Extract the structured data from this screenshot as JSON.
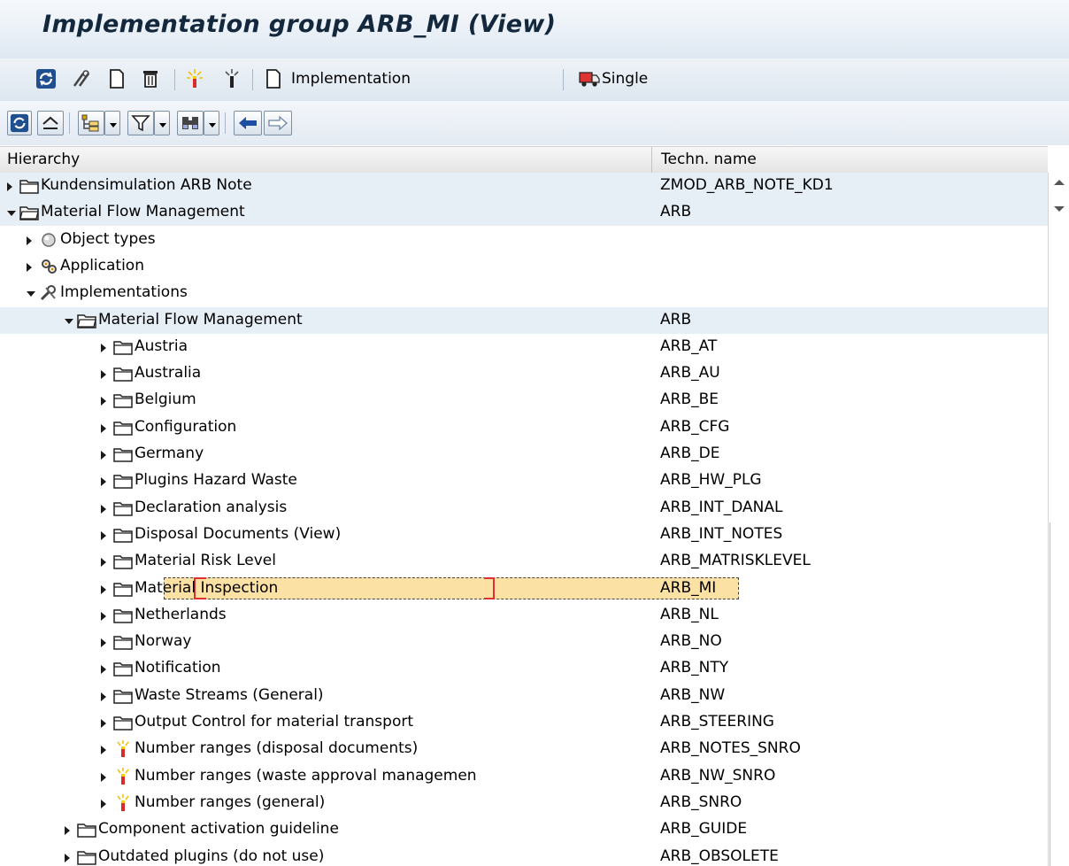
{
  "window": {
    "title": "Implementation group ARB_MI (View)"
  },
  "app_toolbar": {
    "implementation_label": "Implementation",
    "single_label": "Single"
  },
  "tree_header": {
    "hierarchy": "Hierarchy",
    "techn_name": "Techn. name"
  },
  "tree": [
    {
      "label": "Kundensimulation ARB Note",
      "tech": "ZMOD_ARB_NOTE_KD1",
      "level": 0,
      "state": "collapsed",
      "icon": "folder-icon"
    },
    {
      "label": "Material Flow Management",
      "tech": "ARB",
      "level": 0,
      "state": "expanded",
      "icon": "folder-open-icon"
    },
    {
      "label": "Object types",
      "tech": "",
      "level": 1,
      "state": "collapsed",
      "icon": "object-type-icon"
    },
    {
      "label": "Application",
      "tech": "",
      "level": 1,
      "state": "collapsed",
      "icon": "application-icon"
    },
    {
      "label": "Implementations",
      "tech": "",
      "level": 1,
      "state": "expanded",
      "icon": "tools-icon"
    },
    {
      "label": "Material Flow Management",
      "tech": "ARB",
      "level": 2,
      "state": "expanded",
      "icon": "folder-open-icon"
    },
    {
      "label": "Austria",
      "tech": "ARB_AT",
      "level": 3,
      "state": "collapsed",
      "icon": "folder-icon"
    },
    {
      "label": "Australia",
      "tech": "ARB_AU",
      "level": 3,
      "state": "collapsed",
      "icon": "folder-icon"
    },
    {
      "label": "Belgium",
      "tech": "ARB_BE",
      "level": 3,
      "state": "collapsed",
      "icon": "folder-icon"
    },
    {
      "label": "Configuration",
      "tech": "ARB_CFG",
      "level": 3,
      "state": "collapsed",
      "icon": "folder-icon"
    },
    {
      "label": "Germany",
      "tech": "ARB_DE",
      "level": 3,
      "state": "collapsed",
      "icon": "folder-icon"
    },
    {
      "label": "Plugins Hazard Waste",
      "tech": "ARB_HW_PLG",
      "level": 3,
      "state": "collapsed",
      "icon": "folder-icon"
    },
    {
      "label": "Declaration analysis",
      "tech": "ARB_INT_DANAL",
      "level": 3,
      "state": "collapsed",
      "icon": "folder-icon"
    },
    {
      "label": "Disposal Documents (View)",
      "tech": "ARB_INT_NOTES",
      "level": 3,
      "state": "collapsed",
      "icon": "folder-icon"
    },
    {
      "label": "Material Risk Level",
      "tech": "ARB_MATRISKLEVEL",
      "level": 3,
      "state": "collapsed",
      "icon": "folder-icon"
    },
    {
      "label": "Material Inspection",
      "tech": "ARB_MI",
      "level": 3,
      "state": "collapsed",
      "icon": "folder-icon",
      "selected": true
    },
    {
      "label": "Netherlands",
      "tech": "ARB_NL",
      "level": 3,
      "state": "collapsed",
      "icon": "folder-icon"
    },
    {
      "label": "Norway",
      "tech": "ARB_NO",
      "level": 3,
      "state": "collapsed",
      "icon": "folder-icon"
    },
    {
      "label": "Notification",
      "tech": "ARB_NTY",
      "level": 3,
      "state": "collapsed",
      "icon": "folder-icon"
    },
    {
      "label": "Waste Streams (General)",
      "tech": "ARB_NW",
      "level": 3,
      "state": "collapsed",
      "icon": "folder-icon"
    },
    {
      "label": "Output Control for material transport",
      "tech": "ARB_STEERING",
      "level": 3,
      "state": "collapsed",
      "icon": "folder-icon"
    },
    {
      "label": "Number ranges (disposal documents)",
      "tech": "ARB_NOTES_SNRO",
      "level": 3,
      "state": "collapsed",
      "icon": "number-range-icon"
    },
    {
      "label": "Number ranges (waste approval managemen",
      "tech": "ARB_NW_SNRO",
      "level": 3,
      "state": "collapsed",
      "icon": "number-range-icon"
    },
    {
      "label": "Number ranges (general)",
      "tech": "ARB_SNRO",
      "level": 3,
      "state": "collapsed",
      "icon": "number-range-icon"
    },
    {
      "label": "Component activation guideline",
      "tech": "ARB_GUIDE",
      "level": 2,
      "state": "collapsed",
      "icon": "folder-icon"
    },
    {
      "label": "Outdated plugins (do not use)",
      "tech": "ARB_OBSOLETE",
      "level": 2,
      "state": "collapsed",
      "icon": "folder-icon"
    }
  ]
}
